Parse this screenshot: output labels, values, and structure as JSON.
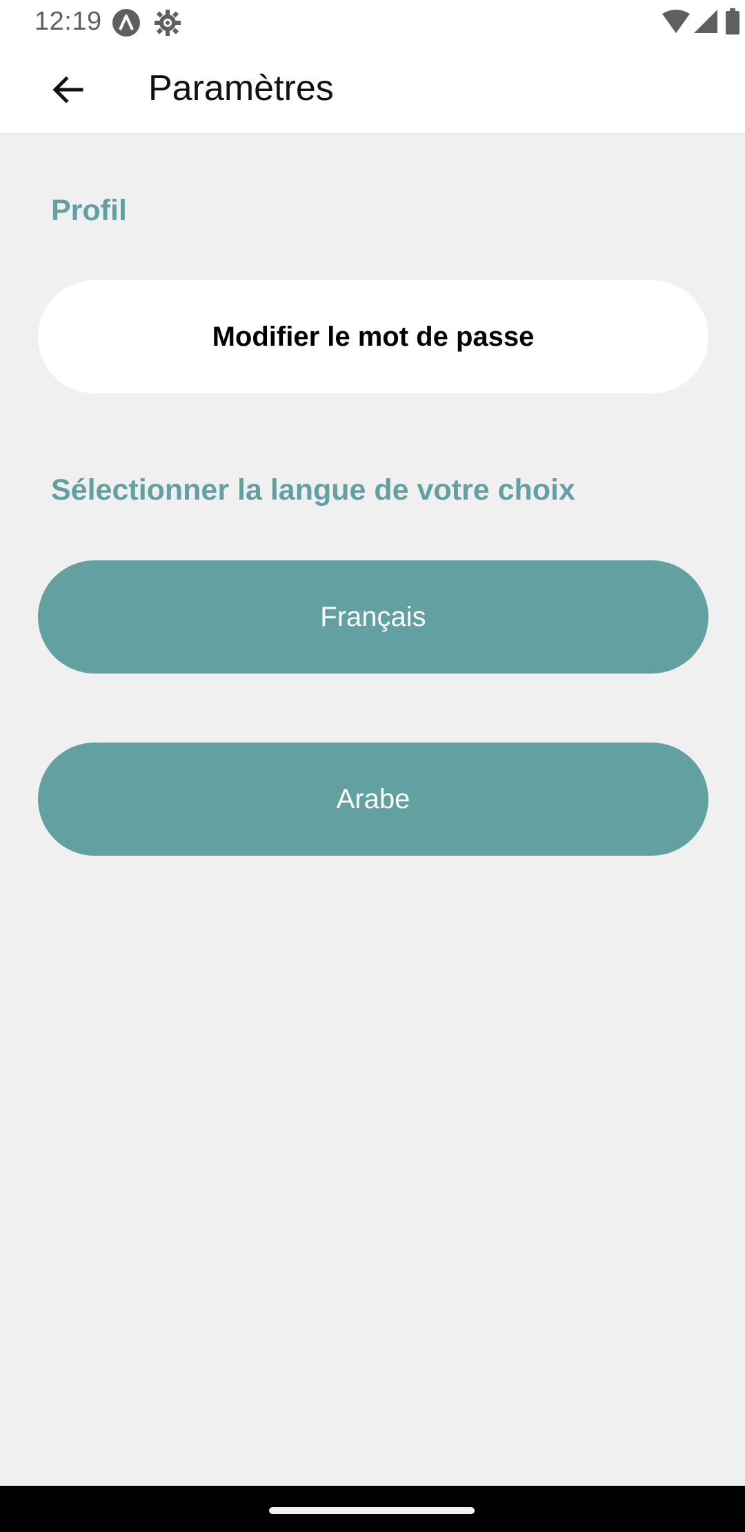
{
  "status_bar": {
    "time": "12:19",
    "left_icons": [
      "android-a-icon",
      "gear-icon"
    ],
    "right_icons": [
      "wifi-icon",
      "signal-icon",
      "battery-icon"
    ]
  },
  "app_bar": {
    "back_icon": "arrow-left-icon",
    "title": "Paramètres"
  },
  "profile_section": {
    "label": "Profil",
    "change_password_label": "Modifier le mot de passe"
  },
  "language_section": {
    "label": "Sélectionner la langue de votre choix",
    "options": [
      "Français",
      "Arabe"
    ]
  },
  "colors": {
    "accent": "#62a0a1",
    "background": "#f0f0f0",
    "surface": "#ffffff",
    "nav_bar": "#000000"
  }
}
